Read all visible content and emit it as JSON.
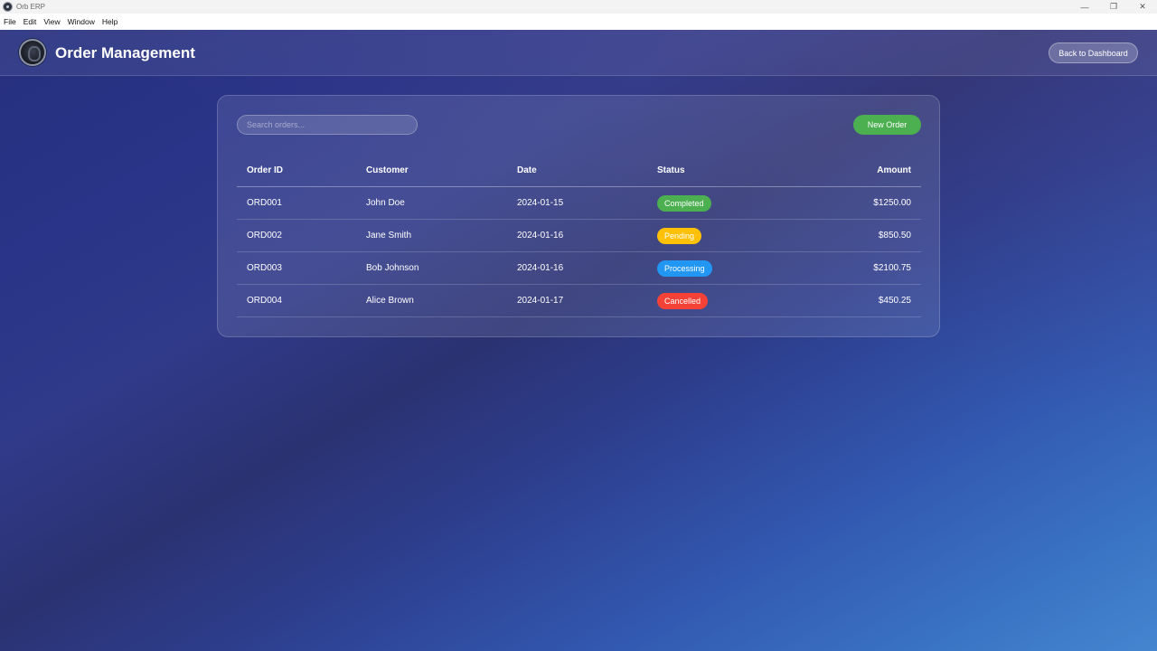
{
  "window": {
    "title": "Orb ERP",
    "controls": {
      "minimize": "—",
      "maximize": "❐",
      "close": "✕"
    }
  },
  "menu": [
    "File",
    "Edit",
    "View",
    "Window",
    "Help"
  ],
  "header": {
    "title": "Order Management",
    "back_label": "Back to Dashboard"
  },
  "toolbar": {
    "search_placeholder": "Search orders...",
    "new_order_label": "New Order"
  },
  "table": {
    "columns": {
      "order_id": "Order ID",
      "customer": "Customer",
      "date": "Date",
      "status": "Status",
      "amount": "Amount"
    },
    "rows": [
      {
        "order_id": "ORD001",
        "customer": "John Doe",
        "date": "2024-01-15",
        "status": "Completed",
        "status_color": "#4caf50",
        "amount": "$1250.00"
      },
      {
        "order_id": "ORD002",
        "customer": "Jane Smith",
        "date": "2024-01-16",
        "status": "Pending",
        "status_color": "#ffc107",
        "amount": "$850.50"
      },
      {
        "order_id": "ORD003",
        "customer": "Bob Johnson",
        "date": "2024-01-16",
        "status": "Processing",
        "status_color": "#2196f3",
        "amount": "$2100.75"
      },
      {
        "order_id": "ORD004",
        "customer": "Alice Brown",
        "date": "2024-01-17",
        "status": "Cancelled",
        "status_color": "#f44336",
        "amount": "$450.25"
      }
    ]
  }
}
